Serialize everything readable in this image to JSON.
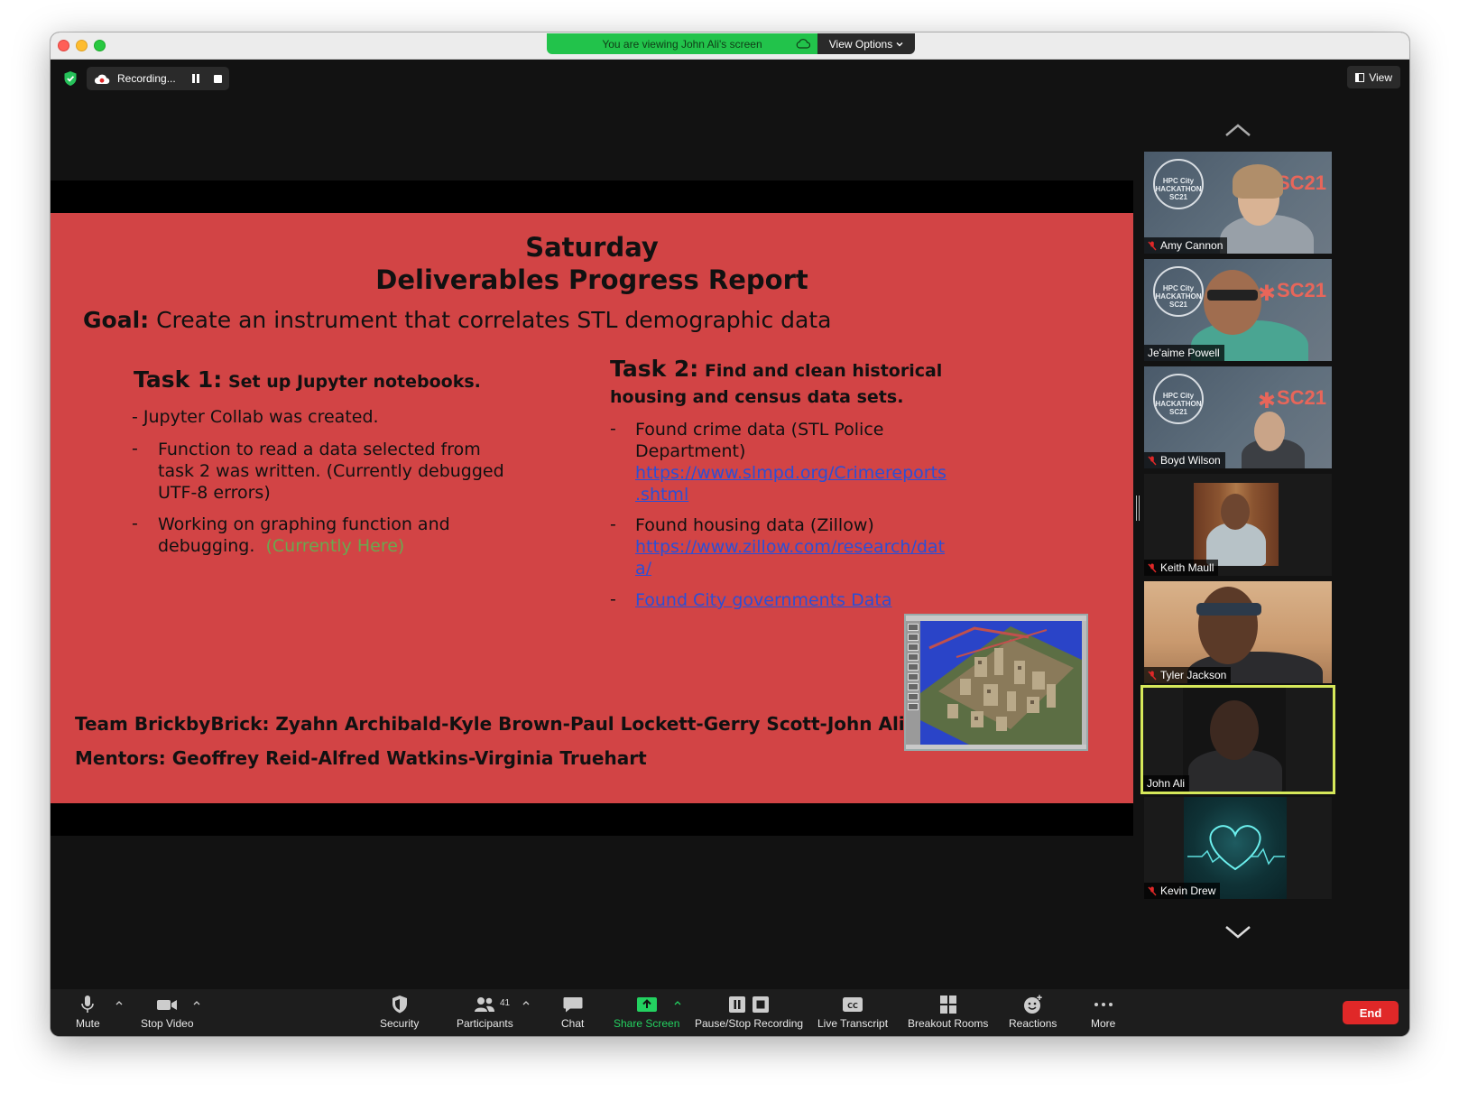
{
  "banner": {
    "viewing_text": "You are viewing John Ali's screen",
    "view_options": "View Options"
  },
  "recording": {
    "label": "Recording..."
  },
  "view_button": "View",
  "slide": {
    "title_line1": "Saturday",
    "title_line2": "Deliverables Progress Report",
    "goal_label": "Goal:",
    "goal_text": "Create an instrument that correlates STL demographic data",
    "task1": {
      "label": "Task 1:",
      "title": "Set up Jupyter notebooks.",
      "intro": "- Jupyter Collab was created.",
      "bullet1_line1": "Function to read a data selected from",
      "bullet1_line2": "task 2 was written. (Currently debugged",
      "bullet1_line3": "UTF-8 errors)",
      "bullet2_line1": "Working on graphing function and",
      "bullet2_line2": "debugging.",
      "bullet2_highlight": "(Currently Here)"
    },
    "task2": {
      "label": "Task 2:",
      "title_line1": "Find and clean historical",
      "title_line2": "housing and census data sets.",
      "bullet1_line1": "Found crime data (STL Police",
      "bullet1_line2": "Department)",
      "bullet1_link1": "https://www.slmpd.org/Crimereports",
      "bullet1_link2": ".shtml",
      "bullet2_line1": "Found housing data (Zillow)",
      "bullet2_link1": "https://www.zillow.com/research/dat",
      "bullet2_link2": "a/",
      "bullet3_link": "Found City governments Data"
    },
    "team": "Team BrickbyBrick: Zyahn Archibald-Kyle Brown-Paul Lockett-Gerry Scott-John Ali",
    "mentors": "Mentors: Geoffrey Reid-Alfred Watkins-Virginia Truehart"
  },
  "participants": [
    {
      "name": "Amy Cannon",
      "muted": true
    },
    {
      "name": "Je'aime Powell",
      "muted": false
    },
    {
      "name": "Boyd Wilson",
      "muted": true
    },
    {
      "name": "Keith Maull",
      "muted": true
    },
    {
      "name": "Tyler Jackson",
      "muted": true
    },
    {
      "name": "John Ali",
      "muted": false,
      "active_speaker": true
    },
    {
      "name": "Kevin Drew",
      "muted": true
    }
  ],
  "hackathon_logo": {
    "line1": "HPC",
    "line2": "City",
    "line3": "HACKATHON",
    "line4": "SC21",
    "brand": "SC21"
  },
  "toolbar": {
    "mute": "Mute",
    "stop_video": "Stop Video",
    "security": "Security",
    "participants": "Participants",
    "participants_count": "41",
    "chat": "Chat",
    "share_screen": "Share Screen",
    "pause_stop_recording": "Pause/Stop Recording",
    "live_transcript": "Live Transcript",
    "breakout_rooms": "Breakout Rooms",
    "reactions": "Reactions",
    "more": "More",
    "end": "End"
  },
  "colors": {
    "slide_bg": "#d24445",
    "active_speaker_border": "#d6e85a",
    "share_green": "#23d160",
    "end_red": "#e02828",
    "link": "#2a4fd6"
  }
}
